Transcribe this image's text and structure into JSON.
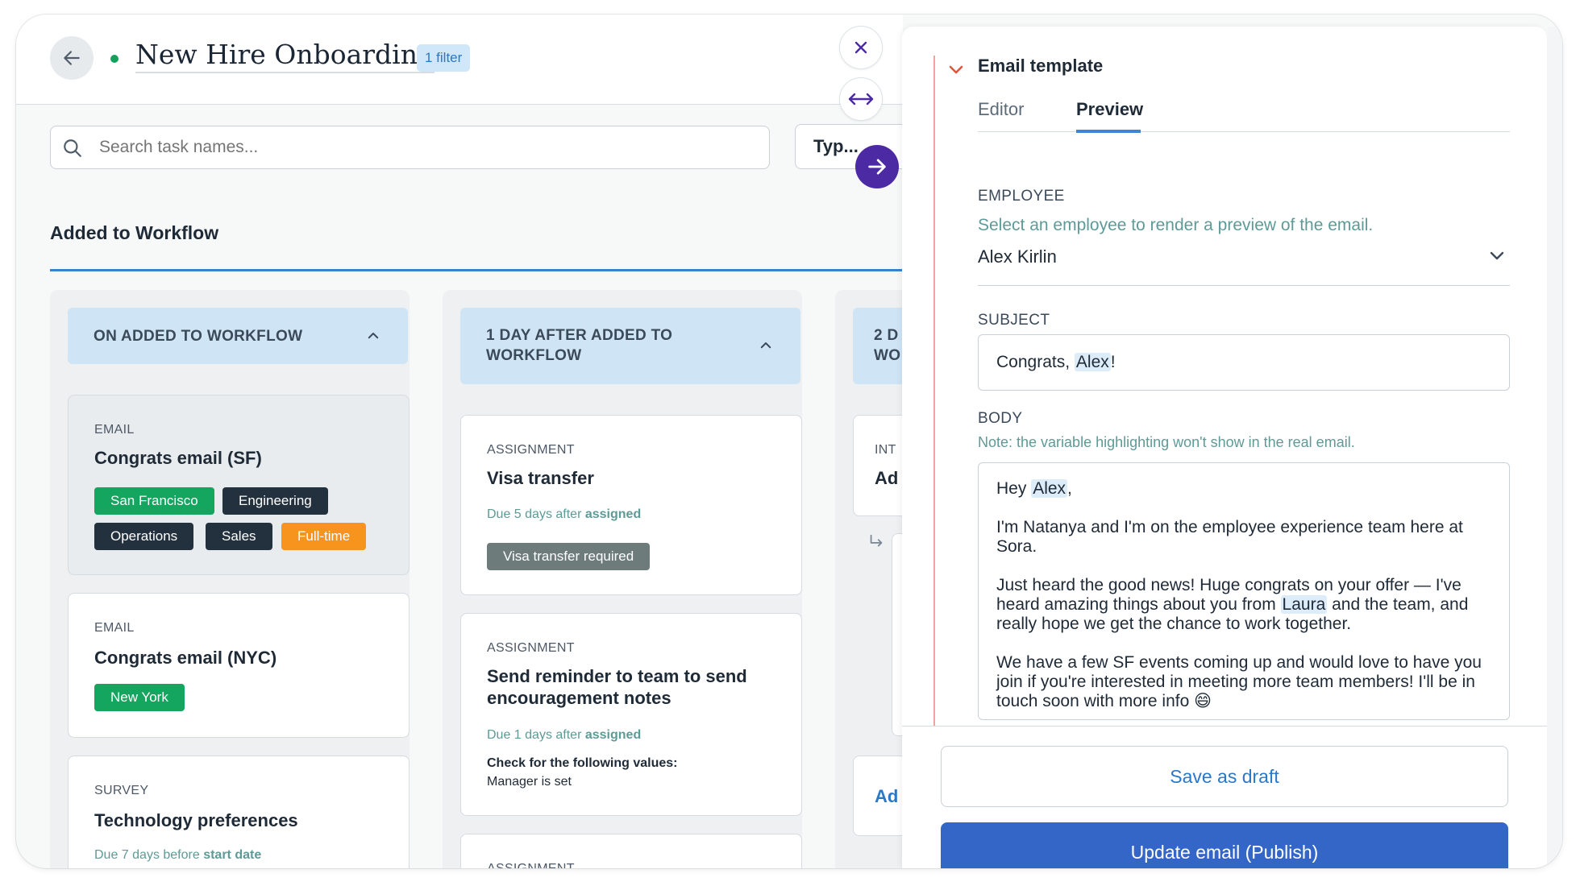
{
  "header": {
    "title": "New Hire Onboarding",
    "filter_badge": "1 filter"
  },
  "search": {
    "placeholder": "Search task names...",
    "value": ""
  },
  "type_filter": {
    "label": "Typ..."
  },
  "section": {
    "title": "Added to Workflow"
  },
  "columns": [
    {
      "header": "ON ADDED TO WORKFLOW",
      "cards": [
        {
          "type": "EMAIL",
          "name": "Congrats email (SF)",
          "tags": [
            "San Francisco",
            "Engineering",
            "Operations",
            "Sales",
            "Full-time"
          ]
        },
        {
          "type": "EMAIL",
          "name": "Congrats email (NYC)",
          "tags": [
            "New York"
          ]
        },
        {
          "type": "SURVEY",
          "name": "Technology preferences",
          "due_prefix": "Due 7 days before",
          "due_bold": "start date"
        }
      ]
    },
    {
      "header_line1": "1 DAY AFTER ADDED TO",
      "header_line2": "WORKFLOW",
      "cards": [
        {
          "type": "ASSIGNMENT",
          "name": "Visa transfer",
          "due_prefix": "Due 5 days after",
          "due_bold": "assigned",
          "tags": [
            "Visa transfer required"
          ]
        },
        {
          "type": "ASSIGNMENT",
          "name_line1": "Send reminder to team to send",
          "name_line2": "encouragement notes",
          "due_prefix": "Due 1 days after",
          "due_bold": "assigned",
          "check_label": "Check for the following values:",
          "check_value": "Manager is set"
        },
        {
          "type": "ASSIGNMENT"
        }
      ]
    },
    {
      "header_line1": "2 D",
      "header_line2": "WO",
      "cards": [
        {
          "type": "INT",
          "name": "Ad"
        },
        {
          "name": "Ad"
        }
      ]
    }
  ],
  "panel": {
    "title": "Email template",
    "tabs": {
      "editor": "Editor",
      "preview": "Preview"
    },
    "employee": {
      "label": "EMPLOYEE",
      "help": "Select an employee to render a preview of the email.",
      "selected": "Alex Kirlin"
    },
    "subject": {
      "label": "SUBJECT",
      "prefix": "Congrats, ",
      "var": "Alex",
      "suffix": "!"
    },
    "body": {
      "label": "BODY",
      "note": "Note: the variable highlighting won't show in the real email.",
      "greeting_prefix": "Hey ",
      "greeting_var": "Alex",
      "greeting_suffix": ",",
      "p1": "I'm Natanya and I'm on the employee experience team here at Sora.",
      "p2_a": "Just heard the good news! Huge congrats on your offer — I've heard amazing things about you from ",
      "p2_var": "Laura",
      "p2_b": " and the team, and really hope we get the chance to work together.",
      "p3": "We have a few SF events coming up and would love to have you join if you're interested in meeting more team members! I'll be in touch soon with more info 😄"
    },
    "buttons": {
      "draft": "Save as draft",
      "publish": "Update email (Publish)"
    }
  },
  "colors": {
    "primary": "#3366c6",
    "accent_purple": "#4b2aa4",
    "green": "#14a55e",
    "dark": "#23313f",
    "orange": "#f7941d",
    "link": "#2a78c8"
  }
}
